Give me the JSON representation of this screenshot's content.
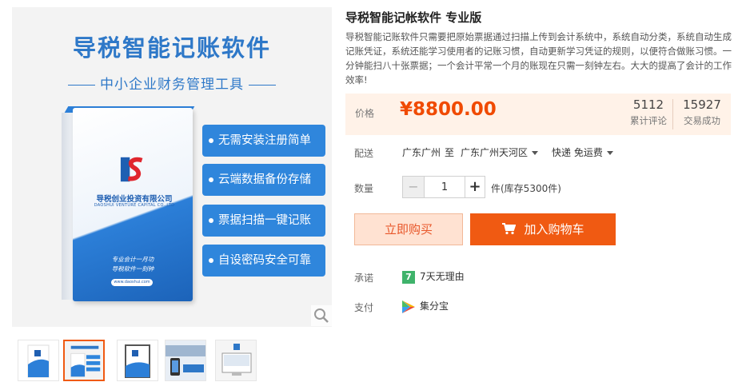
{
  "gallery": {
    "main_title": "导税智能记账软件",
    "main_subtitle": "中小企业财务管理工具",
    "box_company": "导税创业投资有限公司",
    "box_company_en": "DAOSHUI VENTURE CAPITAL CO.,LTD",
    "box_slogan_1": "专业会计一月功",
    "box_slogan_2": "导税软件一刻钟",
    "box_site": "www.daoshui.com",
    "features": [
      "无需安装注册简单",
      "云端数据备份存储",
      "票据扫描一键记账",
      "自设密码安全可靠"
    ],
    "thumb_count": 5,
    "active_thumb": 2
  },
  "product": {
    "title": "导税智能记帐软件 专业版",
    "description": "导税智能记账软件只需要把原始票据通过扫描上传到会计系统中，系统自动分类，系统自动生成记账凭证，系统还能学习使用者的记账习惯，自动更新学习凭证的规则，以便符合做账习惯。一分钟能扫八十张票据；一个会计平常一个月的账现在只需一刻钟左右。大大的提高了会计的工作效率!",
    "price_label": "价格",
    "price": "¥8800.00",
    "reviews_count": "5112",
    "reviews_label": "累计评论",
    "sales_count": "15927",
    "sales_label": "交易成功",
    "shipping_label": "配送",
    "ship_from": "广东广州",
    "ship_to_word": "至",
    "ship_to": "广东广州天河区",
    "ship_method": "快递 免运费",
    "quantity_label": "数量",
    "quantity_minus": "−",
    "quantity_value": "1",
    "quantity_plus": "+",
    "stock_text": "件(库存5300件)",
    "buy_now": "立即购买",
    "add_to_cart": "加入购物车",
    "pledge_label": "承诺",
    "pledge_icon_text": "7",
    "pledge_text": "7天无理由",
    "pay_label": "支付",
    "pay_text": "集分宝"
  },
  "colors": {
    "accent": "#f05a12",
    "price": "#f04a00",
    "brand_blue": "#2e78c8",
    "price_bg": "#fff2e8"
  }
}
